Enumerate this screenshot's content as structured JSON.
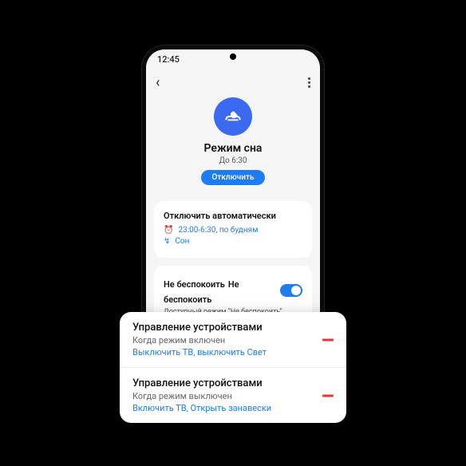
{
  "status": {
    "time": "12:45"
  },
  "hero": {
    "title": "Режим сна",
    "subtitle": "До 6:30",
    "button": "Отключить"
  },
  "schedule": {
    "title": "Отключить автоматически",
    "time_row": "23:00-6:30, по будням",
    "sleep_row": "Сон"
  },
  "dnd": {
    "title_a": "Не беспокоить",
    "title_b": "Не беспокоить",
    "sub_a": "Доступный режим \"Не беспокоить\"",
    "sub_b": "Доступный режим \"Не беспокоить\""
  },
  "overlay": {
    "row1": {
      "title": "Управление устройствами",
      "sub": "Когда режим включен",
      "actions": "Выключить ТВ, выключить Свет"
    },
    "row2": {
      "title": "Управление устройствами",
      "sub": "Когда режим выключен",
      "actions": "Включить ТВ, Открыть занавески"
    }
  },
  "icons": {
    "back": "‹",
    "clock": "⏰",
    "sleep": "↯",
    "recents": "|||",
    "home": "○",
    "nav_back": "‹"
  }
}
